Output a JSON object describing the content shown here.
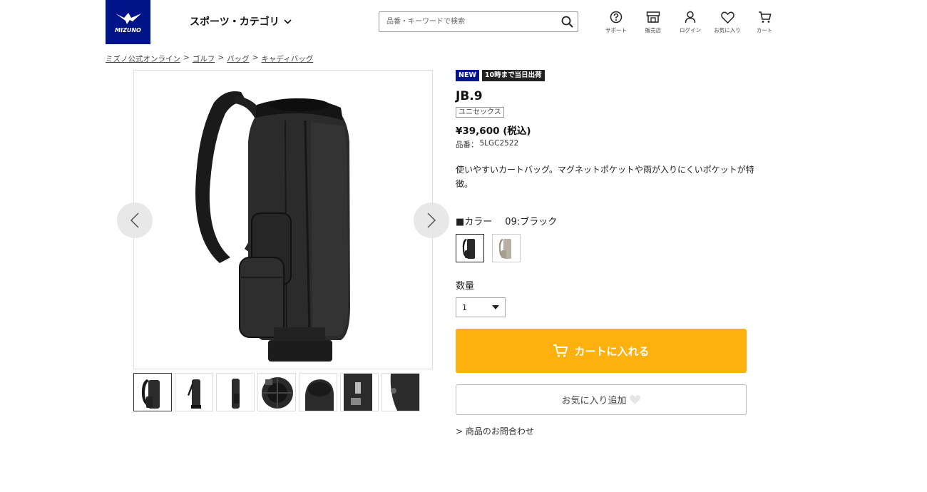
{
  "header": {
    "logo_text": "MIZUNO",
    "category_menu": "スポーツ・カテゴリ",
    "search_placeholder": "品番・キーワードで検索",
    "icons": [
      {
        "name": "support-icon",
        "label": "サポート"
      },
      {
        "name": "store-icon",
        "label": "販売店"
      },
      {
        "name": "login-icon",
        "label": "ログイン"
      },
      {
        "name": "heart-icon",
        "label": "お気に入り"
      },
      {
        "name": "cart-icon",
        "label": "カート"
      }
    ]
  },
  "breadcrumb": {
    "items": [
      "ミズノ公式オンライン",
      "ゴルフ",
      "バッグ",
      "キャディバッグ"
    ],
    "separator": ">"
  },
  "product": {
    "badge_new": "NEW",
    "badge_shipping": "10時まで当日出荷",
    "name": "JB.9",
    "gender": "ユニセックス",
    "price": "¥39,600 (税込)",
    "sku_label": "品番：",
    "sku": "5LGC2522",
    "description": "使いやすいカートバッグ。マグネットポケットや雨が入りにくいポケットが特徴。",
    "color_label": "■カラー",
    "color_value": "09:ブラック",
    "colors": [
      {
        "name": "ブラック",
        "hex": "#2a2a2a",
        "selected": true
      },
      {
        "name": "ベージュ",
        "hex": "#b8b0a2",
        "selected": false
      }
    ],
    "quantity_label": "数量",
    "quantity_value": "1",
    "add_to_cart": "カートに入れる",
    "favorite": "お気に入り追加",
    "inquiry": "> 商品のお問合わせ"
  },
  "gallery": {
    "thumbnail_count": 7,
    "active_index": 0
  },
  "colors": {
    "brand_blue": "#001489",
    "cart_yellow": "#fcb10f",
    "product_black": "#2a2a2a"
  }
}
